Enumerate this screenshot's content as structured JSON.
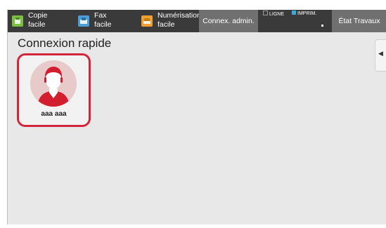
{
  "topbar": {
    "shortcuts": [
      {
        "label_line1": "Copie",
        "label_line2": "facile",
        "icon": "copy-icon",
        "color": "#7bbf3f"
      },
      {
        "label_line1": "Fax",
        "label_line2": "facile",
        "icon": "fax-icon",
        "color": "#4a9fd8"
      },
      {
        "label_line1": "Numérisation",
        "label_line2": "facile",
        "icon": "scan-icon",
        "color": "#f0a030"
      }
    ],
    "admin_login": "Connex. admin.",
    "indicators": {
      "line": "LIGNE",
      "print": "IMPRIM.",
      "print_color": "#3fa7e0"
    },
    "job_status": "État Travaux"
  },
  "main": {
    "title": "Connexion rapide",
    "users": [
      {
        "name": "aaa aaa",
        "avatar": "user-avatar-icon",
        "selected": true,
        "highlight_color": "#d3263b"
      }
    ],
    "side_tab_icon": "arrow-left-icon"
  }
}
